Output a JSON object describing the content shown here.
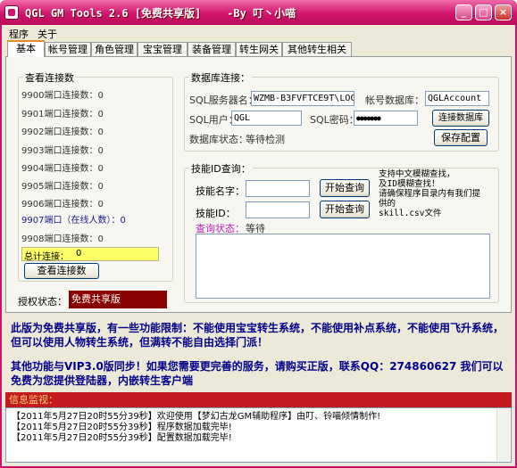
{
  "window": {
    "title": "QGL GM Tools 2.6 [免费共享版]    -By 叮丶小喵"
  },
  "menu": [
    "程序",
    "关于"
  ],
  "tabs": [
    "基本",
    "帐号管理",
    "角色管理",
    "宝宝管理",
    "装备管理",
    "转生网关",
    "其他转生相关"
  ],
  "connections": {
    "group_label": "查看连接数",
    "ports": [
      "9900端口连接数：0",
      "9901端口连接数：0",
      "9902端口连接数：0",
      "9903端口连接数：0",
      "9904端口连接数：0",
      "9905端口连接数：0",
      "9906端口连接数：0",
      "9907端口（在线人数）：0",
      "9908端口连接数：0"
    ],
    "total_label": "总计连接：",
    "total_value": "0",
    "view_button": "查看连接数"
  },
  "auth": {
    "label": "授权状态：",
    "value": "免费共享版"
  },
  "database": {
    "group_label": "数据库连接：",
    "server_label": "SQL服务器名：",
    "server_value": "WZMB-B3FVFTCE9T\\LOCAL",
    "account_db_label": "帐号数据库：",
    "account_db_value": "QGLAccount",
    "user_label": "SQL用户：",
    "user_value": "QGL",
    "password_label": "SQL密码：",
    "password_value": "●●●●●●●",
    "connect_button": "连接数据库",
    "status_label": "数据库状态：",
    "status_value": "等待检测",
    "save_button": "保存配置"
  },
  "skill": {
    "group_label": "技能ID查询：",
    "name_label": "技能名字：",
    "name_button": "开始查询",
    "id_label": "技能ID：",
    "id_button": "开始查询",
    "status_label": "查询状态：",
    "status_value": "等待",
    "hint": [
      "支持中文模糊查找，",
      "及ID模糊查找！",
      "请确保程序目录内有我们提",
      "供的",
      "skill.csv文件"
    ]
  },
  "notice": {
    "para1": "此版为免费共享版，有一些功能限制：不能使用宝宝转生系统，不能使用补点系统，不能使用飞升系统，但可以使用人物转生系统，但满转不能自由选择门派！",
    "para2": "其他功能与VIP3.0版同步！如果您需要更完善的服务，请购买正版，联系QQ：274860627 我们可以免费为您提供登陆器，内嵌转生客户端"
  },
  "log": {
    "header": "信息监视：",
    "lines": [
      "【2011年5月27日20时55分39秒】欢迎使用【梦幻古龙GM辅助程序】由叮、铃喵倾情制作!",
      "【2011年5月27日20时55分39秒】程序数据加载完毕!",
      "【2011年5月27日20时55分39秒】配置数据加载完毕!"
    ]
  },
  "colors": {
    "title_bar": "#d2146c",
    "notice_text": "#00008b",
    "total_bg": "#ffff66",
    "auth_bg": "#8b0000",
    "log_header": "#c41a20"
  }
}
